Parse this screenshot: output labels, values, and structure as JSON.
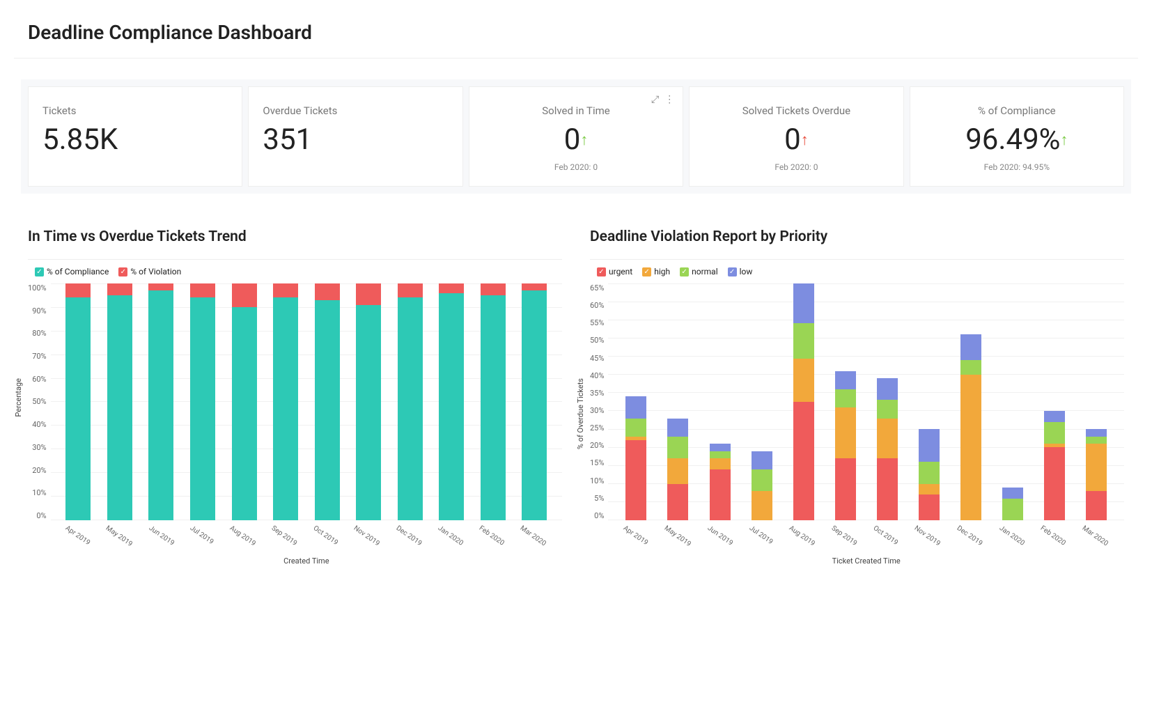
{
  "page_title": "Deadline Compliance Dashboard",
  "cards": {
    "tickets": {
      "label": "Tickets",
      "value": "5.85K"
    },
    "overdue": {
      "label": "Overdue Tickets",
      "value": "351"
    },
    "solved_in_time": {
      "label": "Solved in Time",
      "value": "0",
      "arrow": "up-green",
      "sub": "Feb 2020: 0"
    },
    "solved_overdue": {
      "label": "Solved Tickets Overdue",
      "value": "0",
      "arrow": "up-red",
      "sub": "Feb 2020: 0"
    },
    "compliance": {
      "label": "% of Compliance",
      "value": "96.49%",
      "arrow": "up-green",
      "sub": "Feb 2020: 94.95%"
    }
  },
  "colors": {
    "teal": "#2dc9b5",
    "red": "#ef5b5b",
    "orange": "#f2a83b",
    "green": "#9ad554",
    "blue": "#7d8de0"
  },
  "chart1": {
    "title": "In Time vs Overdue Tickets Trend",
    "legend": [
      {
        "label": "% of Compliance",
        "color": "#2dc9b5"
      },
      {
        "label": "% of Violation",
        "color": "#ef5b5b"
      }
    ],
    "ylabel": "Percentage",
    "xlabel": "Created Time"
  },
  "chart2": {
    "title": "Deadline Violation Report by Priority",
    "legend": [
      {
        "label": "urgent",
        "color": "#ef5b5b"
      },
      {
        "label": "high",
        "color": "#f2a83b"
      },
      {
        "label": "normal",
        "color": "#9ad554"
      },
      {
        "label": "low",
        "color": "#7d8de0"
      }
    ],
    "ylabel": "% of Overdue Tickets",
    "xlabel": "Ticket Created Time"
  },
  "chart_data": [
    {
      "id": "in_time_vs_overdue",
      "type": "bar",
      "stacked": true,
      "title": "In Time vs Overdue Tickets Trend",
      "xlabel": "Created Time",
      "ylabel": "Percentage",
      "ylim": [
        0,
        100
      ],
      "yticks": [
        0,
        10,
        20,
        30,
        40,
        50,
        60,
        70,
        80,
        90,
        100
      ],
      "categories": [
        "Apr 2019",
        "May 2019",
        "Jun 2019",
        "Jul 2019",
        "Aug 2019",
        "Sep 2019",
        "Oct 2019",
        "Nov 2019",
        "Dec 2019",
        "Jan 2020",
        "Feb 2020",
        "Mar 2020"
      ],
      "series": [
        {
          "name": "% of Compliance",
          "color": "#2dc9b5",
          "values": [
            94,
            95,
            97,
            94,
            90,
            94,
            93,
            91,
            94,
            96,
            95,
            97
          ]
        },
        {
          "name": "% of Violation",
          "color": "#ef5b5b",
          "values": [
            6,
            5,
            3,
            6,
            10,
            6,
            7,
            9,
            6,
            4,
            5,
            3
          ]
        }
      ]
    },
    {
      "id": "violation_by_priority",
      "type": "bar",
      "stacked": true,
      "title": "Deadline Violation Report by Priority",
      "xlabel": "Ticket Created Time",
      "ylabel": "% of Overdue Tickets",
      "ylim": [
        0,
        65
      ],
      "yticks": [
        0,
        5,
        10,
        15,
        20,
        25,
        30,
        35,
        40,
        45,
        50,
        55,
        60,
        65
      ],
      "categories": [
        "Apr 2019",
        "May 2019",
        "Jun 2019",
        "Jul 2019",
        "Aug 2019",
        "Sep 2019",
        "Oct 2019",
        "Nov 2019",
        "Dec 2019",
        "Jan 2020",
        "Feb 2020",
        "Mar 2020"
      ],
      "series": [
        {
          "name": "urgent",
          "color": "#ef5b5b",
          "values": [
            22,
            10,
            14,
            0,
            33,
            17,
            17,
            7,
            0,
            0,
            20,
            8
          ]
        },
        {
          "name": "high",
          "color": "#f2a83b",
          "values": [
            1,
            7,
            3,
            8,
            12,
            14,
            11,
            3,
            40,
            0,
            1,
            13
          ]
        },
        {
          "name": "normal",
          "color": "#9ad554",
          "values": [
            5,
            6,
            2,
            6,
            10,
            5,
            5,
            6,
            4,
            6,
            6,
            2
          ]
        },
        {
          "name": "low",
          "color": "#7d8de0",
          "values": [
            6,
            5,
            2,
            5,
            11,
            5,
            6,
            9,
            7,
            3,
            3,
            2
          ]
        }
      ]
    }
  ]
}
